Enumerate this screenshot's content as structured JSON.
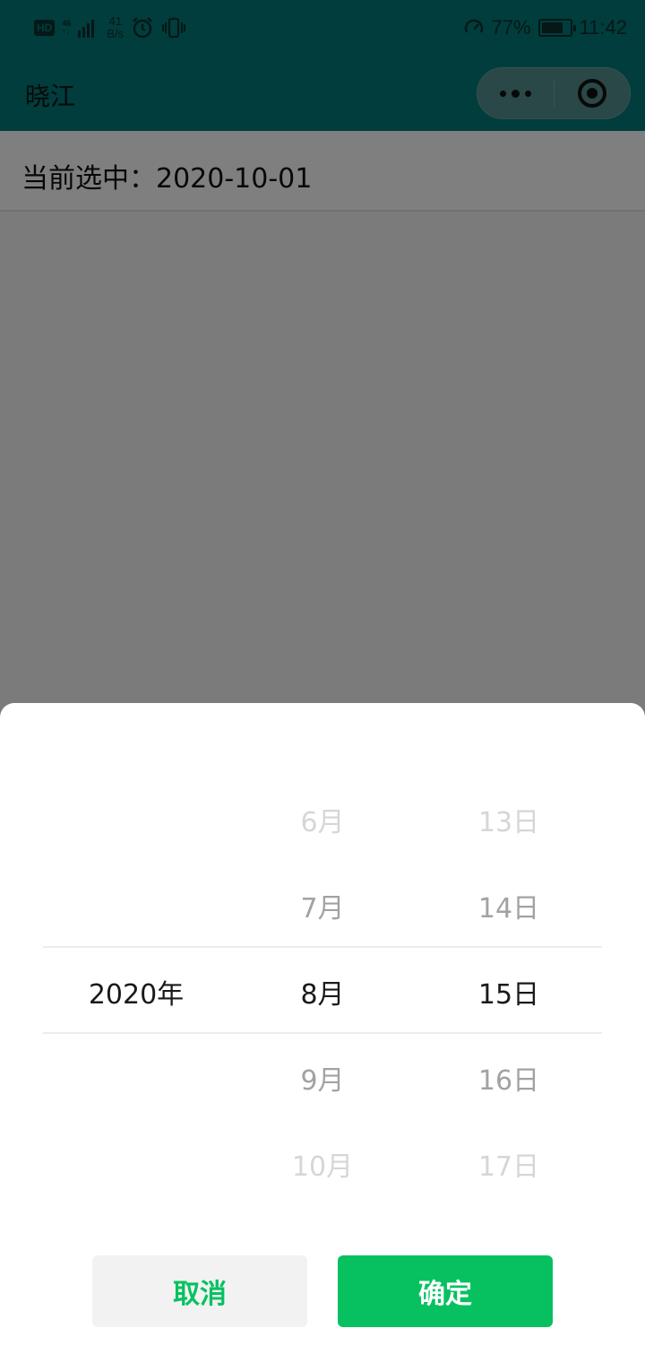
{
  "status_bar": {
    "hd": "HD",
    "network": "46",
    "speed_value": "41",
    "speed_unit": "B/s",
    "battery_percent": "77%",
    "battery_level": 0.77,
    "time": "11:42",
    "icons": [
      "signal-icon",
      "alarm-icon",
      "vibrate-icon",
      "data-saver-icon",
      "battery-icon"
    ]
  },
  "nav": {
    "title": "晓江",
    "capsule_icons": [
      "more-dots-icon",
      "close-target-icon"
    ]
  },
  "page": {
    "selected_text": "当前选中：2020-10-01"
  },
  "picker": {
    "years": [
      "",
      "",
      "2020年",
      "",
      ""
    ],
    "months": [
      "6月",
      "7月",
      "8月",
      "9月",
      "10月"
    ],
    "days": [
      "13日",
      "14日",
      "15日",
      "16日",
      "17日"
    ],
    "cancel_label": "取消",
    "confirm_label": "确定"
  },
  "colors": {
    "header_bg": "#007b78",
    "accent_green": "#07c160"
  }
}
